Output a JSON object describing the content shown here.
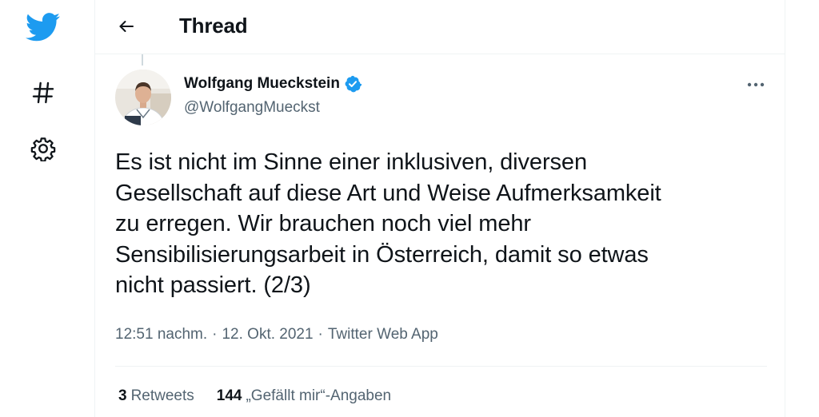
{
  "colors": {
    "brand": "#1d9bf0",
    "text_primary": "#0f1419",
    "text_secondary": "#536471",
    "border": "#eff3f4"
  },
  "nav": {
    "items": [
      {
        "icon": "twitter-logo-icon"
      },
      {
        "icon": "hashtag-explore-icon"
      },
      {
        "icon": "settings-gear-icon"
      }
    ]
  },
  "header": {
    "back_icon": "arrow-left-icon",
    "title": "Thread"
  },
  "tweet": {
    "author": {
      "name": "Wolfgang Mueckstein",
      "handle": "@WolfgangMueckst",
      "verified": true
    },
    "more_icon": "more-horizontal-icon",
    "text": "Es ist nicht im Sinne einer inklusiven, diversen\nGesellschaft auf diese Art und Weise Aufmerksamkeit\nzu erregen. Wir brauchen noch viel mehr\nSensibilisierungsarbeit in Österreich, damit so etwas\nnicht passiert. (2/3)",
    "time": "12:51 nachm.",
    "separator": "·",
    "date": "12. Okt. 2021",
    "source": "Twitter Web App",
    "stats": {
      "retweets_count": "3",
      "retweets_label": "Retweets",
      "likes_count": "144",
      "likes_label": "„Gefällt mir“-Angaben"
    }
  }
}
